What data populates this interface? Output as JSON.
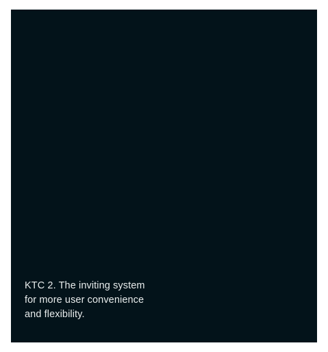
{
  "panel": {
    "caption": "KTC 2. The inviting system\nfor more user convenience\nand flexibility.",
    "background_color": "#03131A",
    "text_color": "#E8ECEC"
  }
}
